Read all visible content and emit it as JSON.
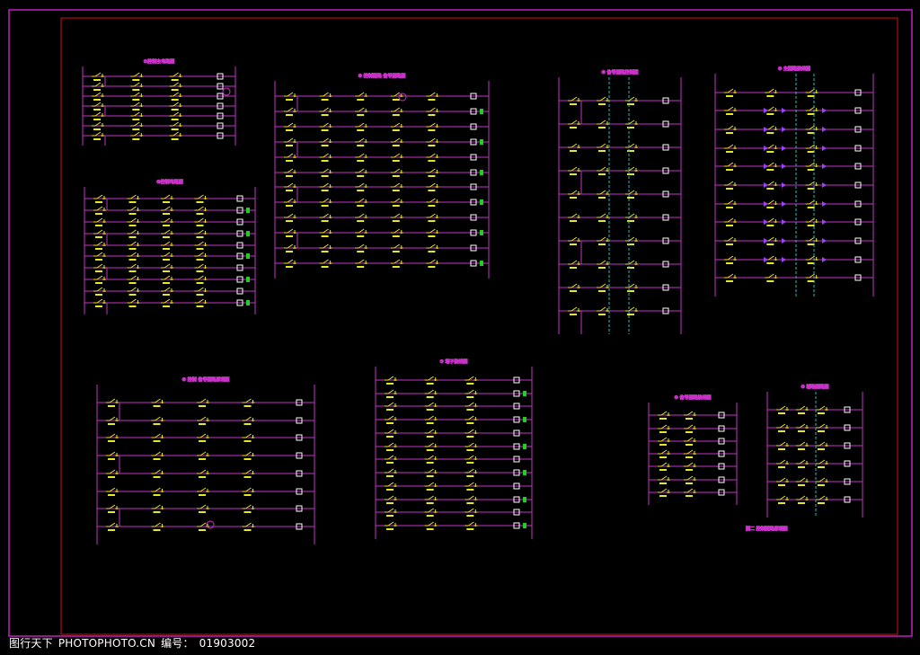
{
  "footer": {
    "brand": "图行天下",
    "site": "PHOTOPHOTO.CN",
    "id_label": "编号：",
    "id_value": "01903002"
  },
  "colors": {
    "background": "#000000",
    "outer_frame": "#c21fc2",
    "inner_frame": "#d01010",
    "wire": "#c832c8",
    "component": "#e8e820",
    "coil": "#ffffff",
    "indicator": "#20d020",
    "bus": "#20c0c0",
    "diode": "#a040ff"
  },
  "diagrams": [
    {
      "id": "d1",
      "title": "①控制主电路图"
    },
    {
      "id": "d2",
      "title": "②控制电路图"
    },
    {
      "id": "d3",
      "title": "③ 控制回路 信号回路图"
    },
    {
      "id": "d4",
      "title": "④ 信号回路控制图"
    },
    {
      "id": "d5",
      "title": "⑤ 主回路接线图"
    },
    {
      "id": "d6",
      "title": "⑥ 控制 信号回路原理图"
    },
    {
      "id": "d7",
      "title": "⑦ 端子接线图"
    },
    {
      "id": "d8",
      "title": "⑧ 信号回路接线图"
    },
    {
      "id": "d9",
      "title": "⑨ 辅助回路图"
    },
    {
      "id": "d10",
      "title": "图二 控制回路原理图"
    }
  ]
}
